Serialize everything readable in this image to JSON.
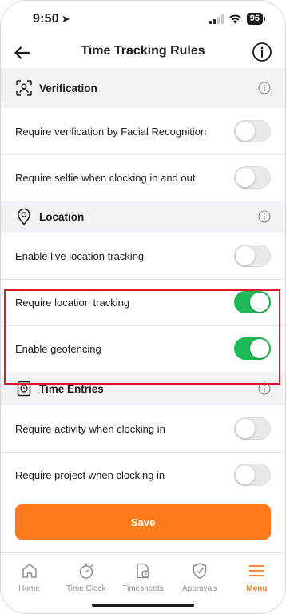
{
  "status_bar": {
    "time": "9:50",
    "battery": "96"
  },
  "header": {
    "title": "Time Tracking Rules"
  },
  "sections": [
    {
      "title": "Verification",
      "icon": "face-scan-icon",
      "rows": [
        {
          "label": "Require verification by Facial Recognition",
          "enabled": false
        },
        {
          "label": "Require selfie when clocking in and out",
          "enabled": false
        }
      ]
    },
    {
      "title": "Location",
      "icon": "location-pin-icon",
      "rows": [
        {
          "label": "Enable live location tracking",
          "enabled": false
        },
        {
          "label": "Require location tracking",
          "enabled": true
        },
        {
          "label": "Enable geofencing",
          "enabled": true
        }
      ]
    },
    {
      "title": "Time Entries",
      "icon": "time-entry-icon",
      "rows": [
        {
          "label": "Require activity when clocking in",
          "enabled": false
        },
        {
          "label": "Require project when clocking in",
          "enabled": false
        }
      ]
    }
  ],
  "save_label": "Save",
  "tabs": [
    {
      "label": "Home",
      "icon": "home-icon",
      "active": false
    },
    {
      "label": "Time Clock",
      "icon": "stopwatch-icon",
      "active": false
    },
    {
      "label": "Timesheets",
      "icon": "timesheet-icon",
      "active": false
    },
    {
      "label": "Approvals",
      "icon": "shield-check-icon",
      "active": false
    },
    {
      "label": "Menu",
      "icon": "menu-icon",
      "active": true
    }
  ],
  "colors": {
    "accent": "#ff7a1a",
    "toggle_on": "#1db954",
    "highlight": "#e0192a"
  }
}
